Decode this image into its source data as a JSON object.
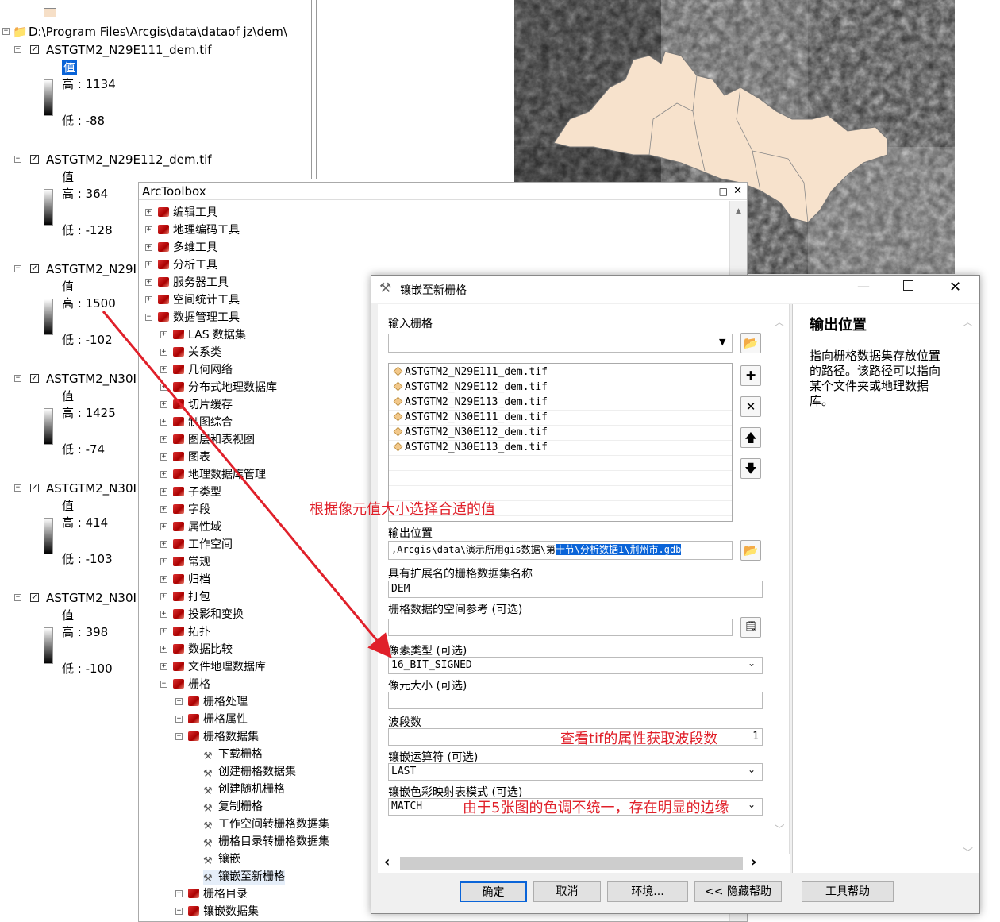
{
  "toc": {
    "path": "D:\\Program Files\\Arcgis\\data\\dataof jz\\dem\\",
    "value_label": "值",
    "layers": [
      {
        "name": "ASTGTM2_N29E111_dem.tif",
        "high": "高 : 1134",
        "low": "低 : -88"
      },
      {
        "name": "ASTGTM2_N29E112_dem.tif",
        "high": "高 : 364",
        "low": "低 : -128"
      },
      {
        "name": "ASTGTM2_N29I",
        "high": "高 : 1500",
        "low": "低 : -102"
      },
      {
        "name": "ASTGTM2_N30I",
        "high": "高 : 1425",
        "low": "低 : -74"
      },
      {
        "name": "ASTGTM2_N30I",
        "high": "高 : 414",
        "low": "低 : -103"
      },
      {
        "name": "ASTGTM2_N30I",
        "high": "高 : 398",
        "low": "低 : -100"
      }
    ]
  },
  "toolbox": {
    "title": "ArcToolbox",
    "items": [
      {
        "label": "编辑工具",
        "icon": "toolbox-icon"
      },
      {
        "label": "地理编码工具",
        "icon": "toolbox-icon"
      },
      {
        "label": "多维工具",
        "icon": "toolbox-icon"
      },
      {
        "label": "分析工具",
        "icon": "toolbox-icon"
      },
      {
        "label": "服务器工具",
        "icon": "toolbox-icon"
      },
      {
        "label": "空间统计工具",
        "icon": "toolbox-icon"
      },
      {
        "label": "数据管理工具",
        "icon": "toolbox-icon"
      },
      {
        "label": "LAS 数据集",
        "icon": "toolset-icon"
      },
      {
        "label": "关系类",
        "icon": "toolset-icon"
      },
      {
        "label": "几何网络",
        "icon": "toolset-icon"
      },
      {
        "label": "分布式地理数据库",
        "icon": "toolset-icon"
      },
      {
        "label": "切片缓存",
        "icon": "toolset-icon"
      },
      {
        "label": "制图综合",
        "icon": "toolset-icon"
      },
      {
        "label": "图层和表视图",
        "icon": "toolset-icon"
      },
      {
        "label": "图表",
        "icon": "toolset-icon"
      },
      {
        "label": "地理数据库管理",
        "icon": "toolset-icon"
      },
      {
        "label": "子类型",
        "icon": "toolset-icon"
      },
      {
        "label": "字段",
        "icon": "toolset-icon"
      },
      {
        "label": "属性域",
        "icon": "toolset-icon"
      },
      {
        "label": "工作空间",
        "icon": "toolset-icon"
      },
      {
        "label": "常规",
        "icon": "toolset-icon"
      },
      {
        "label": "归档",
        "icon": "toolset-icon"
      },
      {
        "label": "打包",
        "icon": "toolset-icon"
      },
      {
        "label": "投影和变换",
        "icon": "toolset-icon"
      },
      {
        "label": "拓扑",
        "icon": "toolset-icon"
      },
      {
        "label": "数据比较",
        "icon": "toolset-icon"
      },
      {
        "label": "文件地理数据库",
        "icon": "toolset-icon"
      },
      {
        "label": "栅格",
        "icon": "toolset-icon"
      },
      {
        "label": "栅格处理",
        "icon": "toolset-icon"
      },
      {
        "label": "栅格属性",
        "icon": "toolset-icon"
      },
      {
        "label": "栅格数据集",
        "icon": "toolset-icon"
      },
      {
        "label": "下载栅格",
        "icon": "hammer-icon"
      },
      {
        "label": "创建栅格数据集",
        "icon": "hammer-icon"
      },
      {
        "label": "创建随机栅格",
        "icon": "hammer-icon"
      },
      {
        "label": "复制栅格",
        "icon": "hammer-icon"
      },
      {
        "label": "工作空间转栅格数据集",
        "icon": "hammer-icon"
      },
      {
        "label": "栅格目录转栅格数据集",
        "icon": "hammer-icon"
      },
      {
        "label": "镶嵌",
        "icon": "hammer-icon"
      },
      {
        "label": "镶嵌至新栅格",
        "icon": "hammer-icon"
      },
      {
        "label": "栅格目录",
        "icon": "toolset-icon"
      },
      {
        "label": "镶嵌数据集",
        "icon": "toolset-icon"
      }
    ]
  },
  "dialog": {
    "title": "镶嵌至新栅格",
    "input_label": "输入栅格",
    "input_value": "",
    "rasters": [
      "ASTGTM2_N29E111_dem.tif",
      "ASTGTM2_N29E112_dem.tif",
      "ASTGTM2_N29E113_dem.tif",
      "ASTGTM2_N30E111_dem.tif",
      "ASTGTM2_N30E112_dem.tif",
      "ASTGTM2_N30E113_dem.tif"
    ],
    "output_label": "输出位置",
    "output_prefix": ",Arcgis\\data\\演示所用gis数据\\第",
    "output_selected": "十节\\分析数据1\\荆州市.gdb",
    "name_label": "具有扩展名的栅格数据集名称",
    "name_value": "DEM",
    "sr_label": "栅格数据的空间参考 (可选)",
    "pixel_label": "像素类型 (可选)",
    "pixel_value": "16_BIT_SIGNED",
    "cell_label": "像元大小 (可选)",
    "bands_label": "波段数",
    "bands_value": "1",
    "mosaic_op_label": "镶嵌运算符 (可选)",
    "mosaic_op_value": "LAST",
    "colormap_label": "镶嵌色彩映射表模式 (可选)",
    "colormap_value": "MATCH",
    "help_title": "输出位置",
    "help_text": "指向栅格数据集存放位置的路径。该路径可以指向某个文件夹或地理数据库。",
    "buttons": {
      "ok": "确定",
      "cancel": "取消",
      "env": "环境...",
      "hide_help": "<< 隐藏帮助",
      "tool_help": "工具帮助"
    }
  },
  "annotations": {
    "pixel_note": "根据像元值大小选择合适的值",
    "band_note": "查看tif的属性获取波段数",
    "color_note": "由于5张图的色调不统一，存在明显的边缘",
    "accent": "#e0202a"
  }
}
